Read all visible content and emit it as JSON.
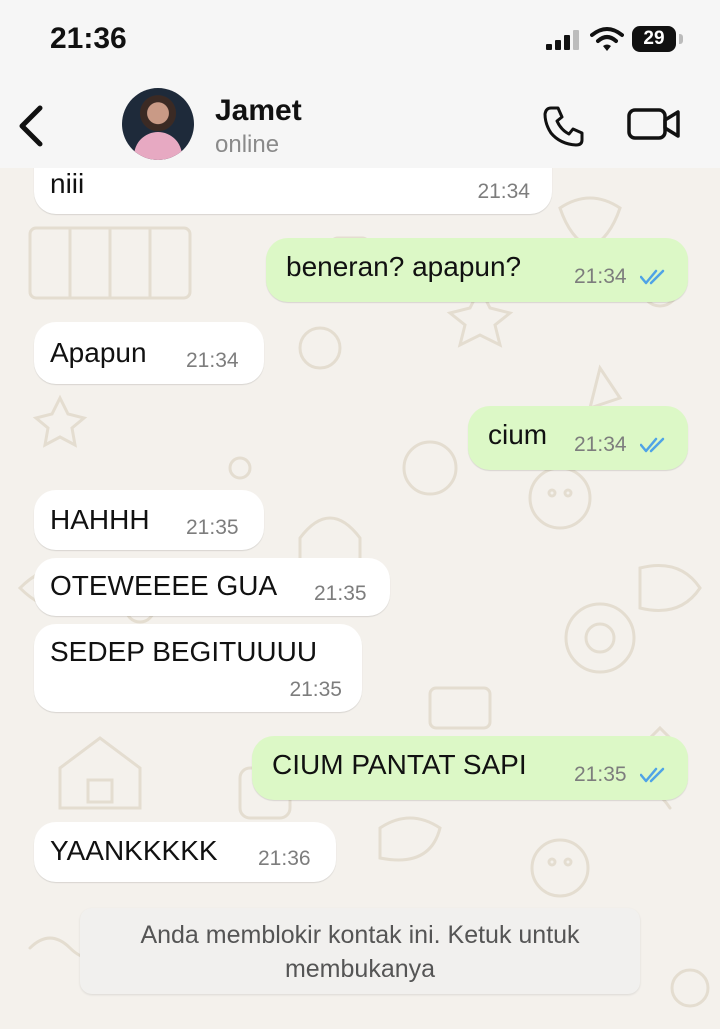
{
  "status_bar": {
    "time": "21:36",
    "battery": "29",
    "icons": [
      "signal-icon",
      "wifi-icon",
      "battery-icon"
    ]
  },
  "header": {
    "contact_name": "Jamet",
    "contact_status": "online",
    "icons": [
      "back-icon",
      "avatar",
      "phone-icon",
      "video-call-icon"
    ]
  },
  "messages": [
    {
      "direction": "in",
      "text": "niii",
      "time": "21:34"
    },
    {
      "direction": "out",
      "text": "beneran? apapun?",
      "time": "21:34",
      "status": "read"
    },
    {
      "direction": "in",
      "text": "Apapun",
      "time": "21:34"
    },
    {
      "direction": "out",
      "text": "cium",
      "time": "21:34",
      "status": "read"
    },
    {
      "direction": "in",
      "text": "HAHHH",
      "time": "21:35"
    },
    {
      "direction": "in",
      "text": "OTEWEEEE GUA",
      "time": "21:35"
    },
    {
      "direction": "in",
      "text": "SEDEP BEGITUUUU",
      "time": "21:35"
    },
    {
      "direction": "out",
      "text": "CIUM PANTAT SAPI",
      "time": "21:35",
      "status": "read"
    },
    {
      "direction": "in",
      "text": "YAANKKKKK",
      "time": "21:36"
    }
  ],
  "blocked_notice": "Anda memblokir kontak ini. Ketuk untuk membukanya",
  "colors": {
    "incoming": "#ffffff",
    "outgoing": "#dcf8c6",
    "read_ticks": "#4fa3e6",
    "wallpaper": "#f4f1ec"
  }
}
